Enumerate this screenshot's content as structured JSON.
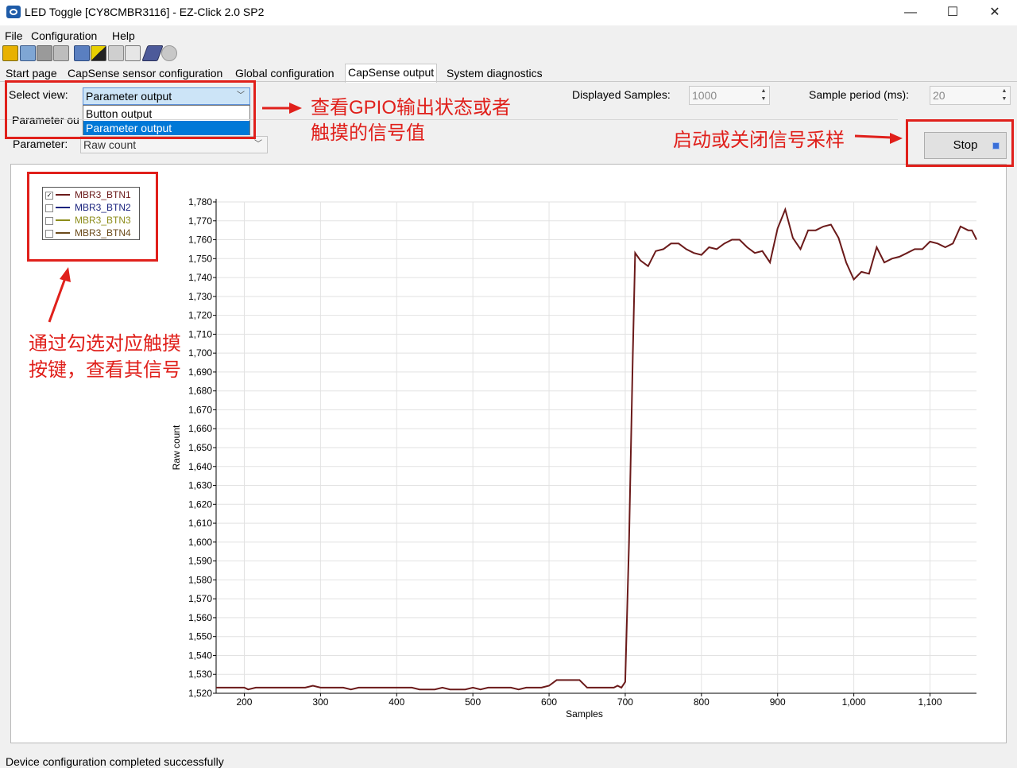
{
  "window": {
    "title": "LED Toggle [CY8CMBR3116] - EZ-Click 2.0 SP2",
    "minimize": "—",
    "maximize": "☐",
    "close": "✕"
  },
  "menu": [
    "File",
    "Configuration",
    "Help"
  ],
  "toolbar_icons": [
    "new-icon",
    "open-icon",
    "save-icon",
    "print-icon",
    "configure-icon",
    "chip-icon",
    "import-icon",
    "export-icon",
    "connect-icon",
    "disconnect-icon"
  ],
  "tabs": [
    {
      "label": "Start page"
    },
    {
      "label": "CapSense sensor configuration"
    },
    {
      "label": "Global configuration"
    },
    {
      "label": "CapSense output"
    },
    {
      "label": "System diagnostics"
    }
  ],
  "controls": {
    "select_view_label": "Select view:",
    "select_view_value": "Parameter output",
    "select_view_options": [
      "Button output",
      "Parameter output"
    ],
    "parameter_output_label": "Parameter ou",
    "parameter_label": "Parameter:",
    "parameter_value": "Raw count",
    "displayed_samples_label": "Displayed Samples:",
    "displayed_samples_value": "1000",
    "sample_period_label": "Sample period (ms):",
    "sample_period_value": "20",
    "stop_button": "Stop"
  },
  "legend": [
    {
      "name": "MBR3_BTN1",
      "checked": true,
      "color": "#6b1a1a",
      "checkmark": "✓"
    },
    {
      "name": "MBR3_BTN2",
      "checked": false,
      "color": "#1a237e",
      "checkmark": ""
    },
    {
      "name": "MBR3_BTN3",
      "checked": false,
      "color": "#8c8c1a",
      "checkmark": ""
    },
    {
      "name": "MBR3_BTN4",
      "checked": false,
      "color": "#6b4a1a",
      "checkmark": ""
    }
  ],
  "annotations": {
    "dropdown_note_line1": "查看GPIO输出状态或者",
    "dropdown_note_line2": "触摸的信号值",
    "stop_note": "启动或关闭信号采样",
    "legend_note_line1": "通过勾选对应触摸",
    "legend_note_line2": "按键，查看其信号"
  },
  "chart_data": {
    "type": "line",
    "xlabel": "Samples",
    "ylabel": "Raw count",
    "xlim": [
      163,
      1161
    ],
    "ylim": [
      1520,
      1780
    ],
    "xticks": [
      200,
      300,
      400,
      500,
      600,
      700,
      800,
      900,
      1000,
      1100
    ],
    "xtick_labels": [
      "200",
      "300",
      "400",
      "500",
      "600",
      "700",
      "800",
      "900",
      "1,000",
      "1,100"
    ],
    "yticks": [
      1520,
      1530,
      1540,
      1550,
      1560,
      1570,
      1580,
      1590,
      1600,
      1610,
      1620,
      1630,
      1640,
      1650,
      1660,
      1670,
      1680,
      1690,
      1700,
      1710,
      1720,
      1730,
      1740,
      1750,
      1760,
      1770,
      1780
    ],
    "ytick_labels": [
      "1,520",
      "1,530",
      "1,540",
      "1,550",
      "1,560",
      "1,570",
      "1,580",
      "1,590",
      "1,600",
      "1,610",
      "1,620",
      "1,630",
      "1,640",
      "1,650",
      "1,660",
      "1,670",
      "1,680",
      "1,690",
      "1,700",
      "1,710",
      "1,720",
      "1,730",
      "1,740",
      "1,750",
      "1,760",
      "1,770",
      "1,780"
    ],
    "grid": true,
    "series": [
      {
        "name": "MBR3_BTN1",
        "color": "#6b1a1a",
        "points": [
          [
            163,
            1523
          ],
          [
            200,
            1523
          ],
          [
            205,
            1522
          ],
          [
            215,
            1523
          ],
          [
            280,
            1523
          ],
          [
            290,
            1524
          ],
          [
            300,
            1523
          ],
          [
            330,
            1523
          ],
          [
            340,
            1522
          ],
          [
            350,
            1523
          ],
          [
            420,
            1523
          ],
          [
            430,
            1522
          ],
          [
            450,
            1522
          ],
          [
            460,
            1523
          ],
          [
            470,
            1522
          ],
          [
            490,
            1522
          ],
          [
            500,
            1523
          ],
          [
            510,
            1522
          ],
          [
            520,
            1523
          ],
          [
            550,
            1523
          ],
          [
            560,
            1522
          ],
          [
            570,
            1523
          ],
          [
            590,
            1523
          ],
          [
            600,
            1524
          ],
          [
            610,
            1527
          ],
          [
            640,
            1527
          ],
          [
            650,
            1523
          ],
          [
            685,
            1523
          ],
          [
            690,
            1524
          ],
          [
            695,
            1523
          ],
          [
            700,
            1526
          ],
          [
            705,
            1600
          ],
          [
            710,
            1700
          ],
          [
            713,
            1753
          ],
          [
            720,
            1749
          ],
          [
            730,
            1746
          ],
          [
            740,
            1754
          ],
          [
            750,
            1755
          ],
          [
            760,
            1758
          ],
          [
            770,
            1758
          ],
          [
            780,
            1755
          ],
          [
            790,
            1753
          ],
          [
            800,
            1752
          ],
          [
            810,
            1756
          ],
          [
            820,
            1755
          ],
          [
            830,
            1758
          ],
          [
            840,
            1760
          ],
          [
            850,
            1760
          ],
          [
            860,
            1756
          ],
          [
            870,
            1753
          ],
          [
            880,
            1754
          ],
          [
            890,
            1748
          ],
          [
            900,
            1766
          ],
          [
            910,
            1776
          ],
          [
            920,
            1761
          ],
          [
            930,
            1755
          ],
          [
            940,
            1765
          ],
          [
            950,
            1765
          ],
          [
            960,
            1767
          ],
          [
            970,
            1768
          ],
          [
            980,
            1761
          ],
          [
            990,
            1748
          ],
          [
            1000,
            1739
          ],
          [
            1010,
            1743
          ],
          [
            1020,
            1742
          ],
          [
            1030,
            1756
          ],
          [
            1040,
            1748
          ],
          [
            1050,
            1750
          ],
          [
            1060,
            1751
          ],
          [
            1070,
            1753
          ],
          [
            1080,
            1755
          ],
          [
            1090,
            1755
          ],
          [
            1100,
            1759
          ],
          [
            1110,
            1758
          ],
          [
            1120,
            1756
          ],
          [
            1130,
            1758
          ],
          [
            1140,
            1767
          ],
          [
            1150,
            1765
          ],
          [
            1155,
            1765
          ],
          [
            1160,
            1761
          ],
          [
            1161,
            1760
          ]
        ]
      }
    ]
  }
}
